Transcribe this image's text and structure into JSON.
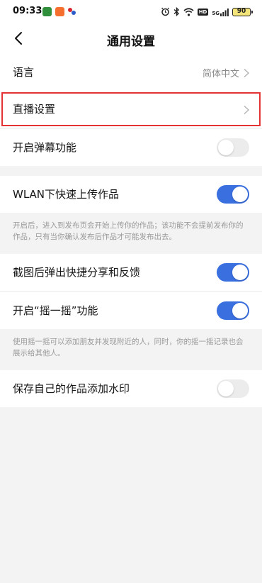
{
  "status_bar": {
    "time": "09:33",
    "battery": "90",
    "hd_label": "HD",
    "network_label": "5G"
  },
  "header": {
    "title": "通用设置",
    "back_icon": "back-arrow-icon"
  },
  "settings": {
    "language": {
      "label": "语言",
      "value": "简体中文"
    },
    "live": {
      "label": "直播设置"
    },
    "danmaku": {
      "label": "开启弹幕功能",
      "enabled": false
    },
    "wlan_upload": {
      "label": "WLAN下快速上传作品",
      "enabled": true
    },
    "wlan_note": "开启后，进入到发布页会开始上传你的作品；该功能不会提前发布你的作品，只有当你确认发布后作品才可能发布出去。",
    "screenshot_share": {
      "label": "截图后弹出快捷分享和反馈",
      "enabled": true
    },
    "shake": {
      "label": "开启“摇一摇”功能",
      "enabled": true
    },
    "shake_note": "使用摇一摇可以添加朋友并发现附近的人，同时，你的摇一摇记录也会展示给其他人。",
    "watermark": {
      "label": "保存自己的作品添加水印",
      "enabled": false
    }
  },
  "colors": {
    "toggle_on": "#3a6fe0",
    "toggle_off": "#ececec",
    "highlight": "#e53232"
  }
}
